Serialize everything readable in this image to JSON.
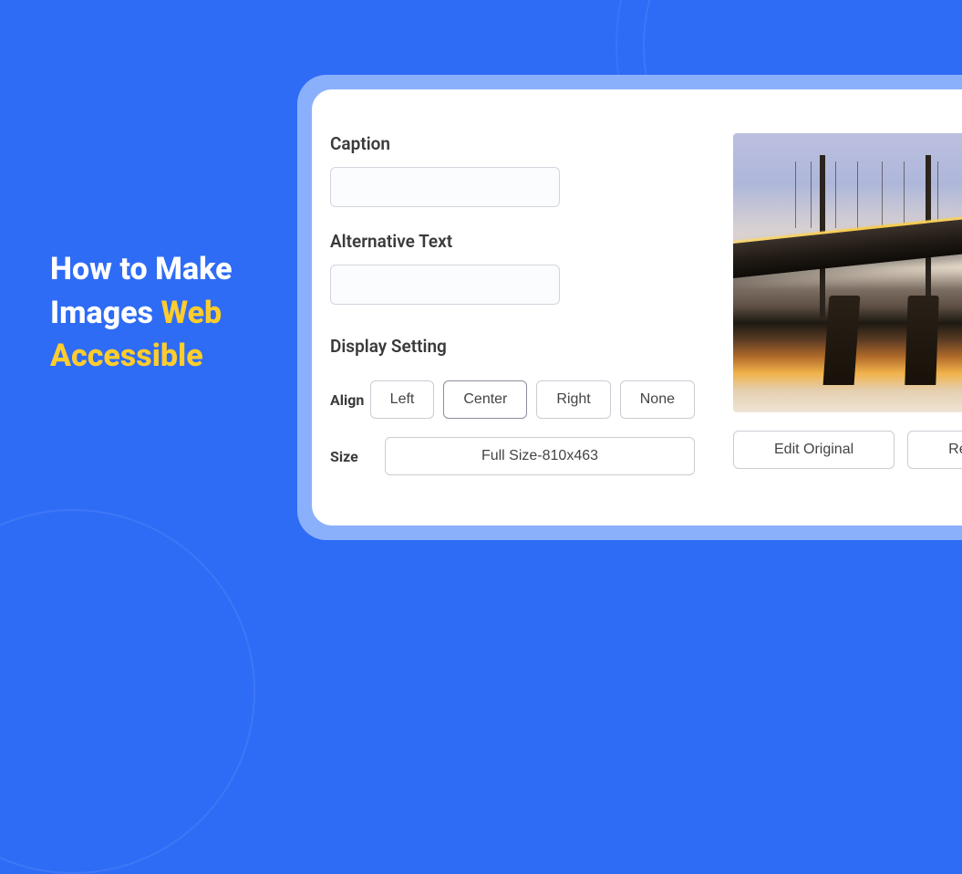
{
  "headline": {
    "line1": "How to Make",
    "line2_plain": "Images ",
    "line2_accent": "Web",
    "line3_accent": "Accessible"
  },
  "form": {
    "caption_label": "Caption",
    "caption_value": "",
    "alt_label": "Alternative Text",
    "alt_value": "",
    "display_setting_label": "Display Setting",
    "align_label": "Align",
    "align_options": {
      "left": "Left",
      "center": "Center",
      "right": "Right",
      "none": "None"
    },
    "align_selected": "Center",
    "size_label": "Size",
    "size_value": "Full Size-810x463"
  },
  "image_actions": {
    "edit_original": "Edit Original",
    "replace": "Replace"
  }
}
